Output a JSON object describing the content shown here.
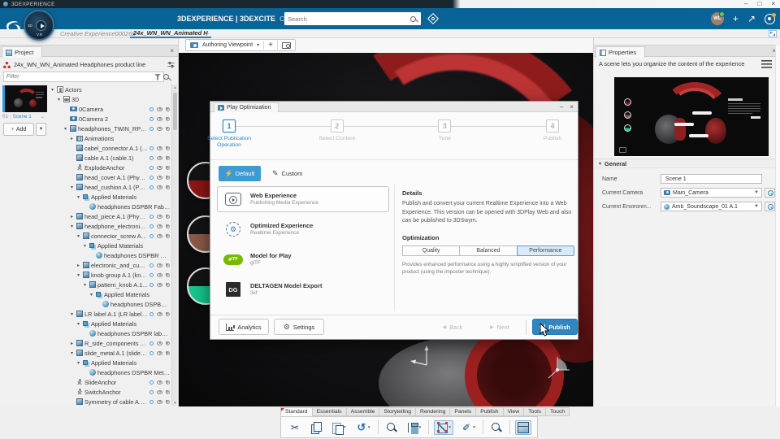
{
  "window": {
    "title": "3DEXPERIENCE"
  },
  "header": {
    "brand": "3DEXPERIENCE | 3DEXCITE",
    "app": "Creative Experience",
    "search_placeholder": "Search",
    "avatar_initials": "WL"
  },
  "doc_tabs": {
    "tabs": [
      {
        "label": "Creative Experience000268",
        "active": false
      },
      {
        "label": "24x_WN_WN_Animated H",
        "active": true
      }
    ]
  },
  "project_panel": {
    "tab_label": "Project",
    "title": "24x_WN_WN_Animated Headphones product line",
    "filter_placeholder": "Filter",
    "scene_index": "01",
    "scene_name": "Scene 1",
    "add_button": "Add",
    "tree": [
      {
        "label": "Actors",
        "indent": 0,
        "arrow": "down",
        "icon": "actors",
        "controls": false
      },
      {
        "label": "3D",
        "indent": 1,
        "arrow": "down",
        "icon": "group3d",
        "controls": false
      },
      {
        "label": "0Camera",
        "indent": 2,
        "arrow": "",
        "icon": "camera",
        "controls": true
      },
      {
        "label": "0Camera 2",
        "indent": 2,
        "arrow": "",
        "icon": "camera",
        "controls": true
      },
      {
        "label": "headphones_TWIN_RPT_Sha...",
        "indent": 2,
        "arrow": "down",
        "icon": "cube",
        "controls": true
      },
      {
        "label": "Animations",
        "indent": 3,
        "arrow": "right",
        "icon": "film",
        "controls": false
      },
      {
        "label": "cabel_connector A.1 (cab...",
        "indent": 3,
        "arrow": "",
        "icon": "cube",
        "controls": true
      },
      {
        "label": "cable A.1 (cable.1)",
        "indent": 3,
        "arrow": "",
        "icon": "cube",
        "controls": true
      },
      {
        "label": "ExplodeAnchor",
        "indent": 3,
        "arrow": "",
        "icon": "anchor",
        "controls": true
      },
      {
        "label": "head_cover A.1 (Physical...",
        "indent": 3,
        "arrow": "",
        "icon": "cube",
        "controls": true
      },
      {
        "label": "head_cushion A.1 (Physi...",
        "indent": 3,
        "arrow": "down",
        "icon": "cube",
        "controls": true
      },
      {
        "label": "Applied Materials",
        "indent": 4,
        "arrow": "down",
        "icon": "mats",
        "controls": false
      },
      {
        "label": "headphones DSPBR Fabric: U...",
        "indent": 5,
        "arrow": "",
        "icon": "matball",
        "controls": false
      },
      {
        "label": "head_piece A.1 (Physical...",
        "indent": 3,
        "arrow": "right",
        "icon": "cube",
        "controls": true
      },
      {
        "label": "headphone_electronics A...",
        "indent": 3,
        "arrow": "down",
        "icon": "cube",
        "controls": true
      },
      {
        "label": "connector_screw A.1...",
        "indent": 4,
        "arrow": "down",
        "icon": "cube",
        "controls": true
      },
      {
        "label": "Applied Materials",
        "indent": 5,
        "arrow": "down",
        "icon": "mats",
        "controls": false
      },
      {
        "label": "headphones DSPBR Meta...",
        "indent": 6,
        "arrow": "",
        "icon": "matball",
        "controls": false
      },
      {
        "label": "electronic_and_cush...",
        "indent": 4,
        "arrow": "right",
        "icon": "cube",
        "controls": true
      },
      {
        "label": "knob group A.1 (kno...",
        "indent": 4,
        "arrow": "down",
        "icon": "cube",
        "controls": true
      },
      {
        "label": "pattern_knob A.1...",
        "indent": 5,
        "arrow": "down",
        "icon": "cube",
        "controls": true
      },
      {
        "label": "Applied Materials",
        "indent": 6,
        "arrow": "down",
        "icon": "mats",
        "controls": false
      },
      {
        "label": "headphones DSPBR F...",
        "indent": 7,
        "arrow": "",
        "icon": "matball",
        "controls": false
      },
      {
        "label": "LR label A.1 (LR label.1)",
        "indent": 3,
        "arrow": "down",
        "icon": "cube",
        "controls": true
      },
      {
        "label": "Applied Materials",
        "indent": 4,
        "arrow": "down",
        "icon": "mats",
        "controls": false
      },
      {
        "label": "headphones DSPBR label wh...",
        "indent": 5,
        "arrow": "",
        "icon": "matball",
        "controls": false
      },
      {
        "label": "R_side_components A.1 ...",
        "indent": 3,
        "arrow": "right",
        "icon": "cube",
        "controls": true
      },
      {
        "label": "slide_metal A.1 (slide_me...",
        "indent": 3,
        "arrow": "down",
        "icon": "cube",
        "controls": true
      },
      {
        "label": "Applied Materials",
        "indent": 4,
        "arrow": "down",
        "icon": "mats",
        "controls": false
      },
      {
        "label": "headphones DSPBR Metal Sa...",
        "indent": 5,
        "arrow": "",
        "icon": "matball",
        "controls": false
      },
      {
        "label": "SlideAnchor",
        "indent": 3,
        "arrow": "",
        "icon": "anchor",
        "controls": true
      },
      {
        "label": "SwitchAnchor",
        "indent": 3,
        "arrow": "",
        "icon": "anchor",
        "controls": true
      },
      {
        "label": "Symmetry of cable A.1 (...",
        "indent": 3,
        "arrow": "",
        "icon": "cube",
        "controls": true
      }
    ]
  },
  "viewport": {
    "viewpoint_label": "Authoring Viewpoint"
  },
  "dialog": {
    "title": "Play Optimization",
    "steps": [
      {
        "num": "1",
        "label": "Select Publication Operation",
        "active": true
      },
      {
        "num": "2",
        "label": "Select Content",
        "active": false
      },
      {
        "num": "3",
        "label": "Tune",
        "active": false
      },
      {
        "num": "4",
        "label": "Publish",
        "active": false
      }
    ],
    "modes": {
      "default_label": "Default",
      "custom_label": "Custom"
    },
    "operations": [
      {
        "title": "Web Experience",
        "subtitle": "Publishing Media Experience",
        "selected": true
      },
      {
        "title": "Optimized Experience",
        "subtitle": "Realtime Experience",
        "selected": false
      },
      {
        "title": "Model for Play",
        "subtitle": "glTF",
        "icon_text": "glTF",
        "selected": false
      },
      {
        "title": "DELTAGEN Model Export",
        "subtitle": "3xf",
        "icon_text": "DG",
        "selected": false
      }
    ],
    "details": {
      "heading": "Details",
      "body": "Publish and convert your current Realtime Experience into a Web Experience. This version can be opened with 3DPlay Web and also can be published to 3DSwym.",
      "optimization_heading": "Optimization",
      "options": [
        {
          "label": "Quality",
          "selected": false
        },
        {
          "label": "Balanced",
          "selected": false
        },
        {
          "label": "Performance",
          "selected": true
        }
      ],
      "note": "Provides enhanced performance using a highly simplified version of your product (using the imposter technique)."
    },
    "footer": {
      "analytics": "Analytics",
      "settings": "Settings",
      "back": "Back",
      "next": "Next",
      "publish": "Publish"
    }
  },
  "properties_panel": {
    "tab_label": "Properties",
    "description": "A scene lets you organize the content of the experience",
    "general": {
      "heading": "General",
      "rows": [
        {
          "label": "Name",
          "value": "Scene 1"
        },
        {
          "label": "Current Camera",
          "value": "Main_Camera"
        },
        {
          "label": "Current Environm...",
          "value": "Amb_Soundscape_01 A.1"
        }
      ]
    }
  },
  "bottom_bar": {
    "tabs": [
      "Standard",
      "Essentials",
      "Assemble",
      "Storytelling",
      "Rendering",
      "Panels",
      "Publish",
      "View",
      "Tools",
      "Touch"
    ],
    "active_tab": "Standard",
    "icons": [
      {
        "name": "cut"
      },
      {
        "name": "copy"
      },
      {
        "name": "paste",
        "dropdown": true
      },
      {
        "name": "undo",
        "dropdown": true,
        "sep_after": true
      },
      {
        "name": "zoom-selection"
      },
      {
        "name": "scene-graph",
        "dropdown": true,
        "sep_after": true
      },
      {
        "name": "transform",
        "active": true,
        "dropdown": true
      },
      {
        "name": "annotate",
        "dropdown": true,
        "sep_after": true
      },
      {
        "name": "search",
        "sep_after": true
      },
      {
        "name": "view-cube",
        "active": true
      }
    ]
  },
  "colors": {
    "header_blue": "#0a6397",
    "accent_blue": "#3e9ad2",
    "publish_blue": "#2f86c1",
    "selected_light_blue": "#dbeaf6"
  }
}
